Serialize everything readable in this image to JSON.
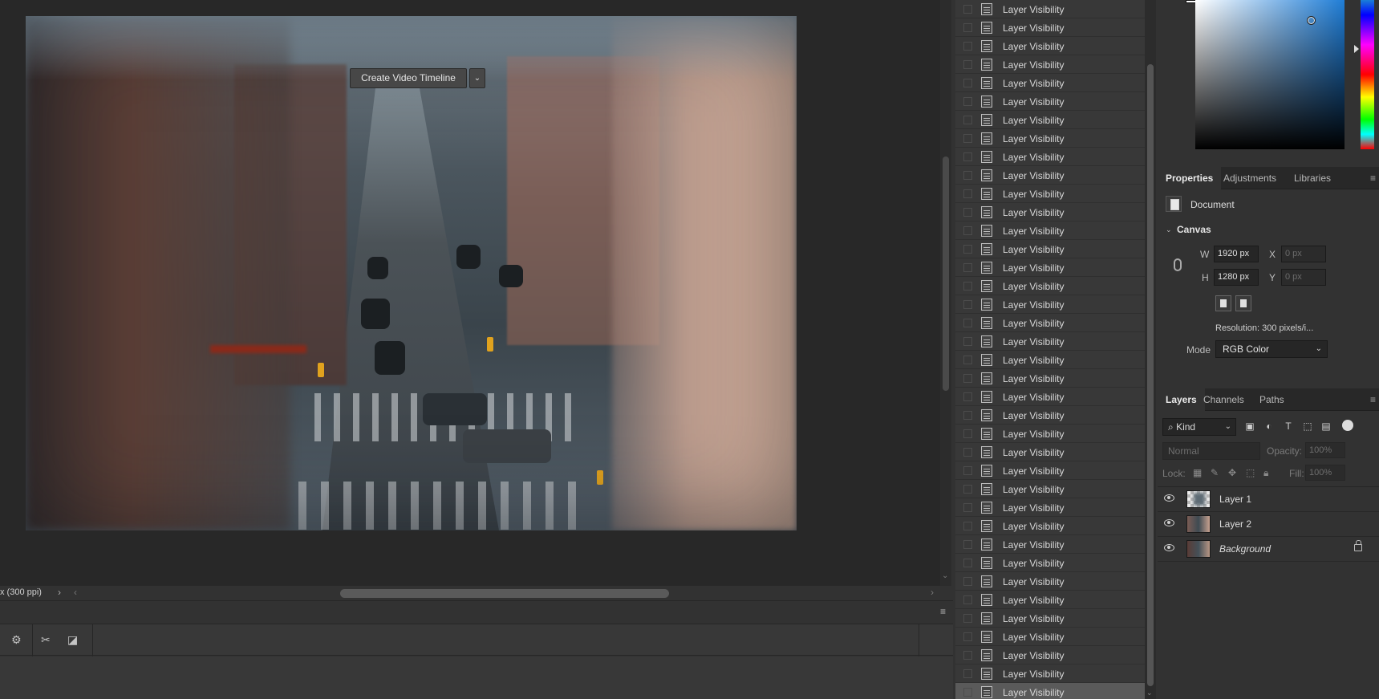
{
  "document": {
    "zoom_status": "x (300 ppi)"
  },
  "timeline": {
    "create_button_label": "Create Video Timeline"
  },
  "history": {
    "item_label": "Layer Visibility",
    "item_count": 38
  },
  "color": {
    "foreground": "#ffffff",
    "field_hue": "#1f7dd6"
  },
  "properties": {
    "tabs": [
      "Properties",
      "Adjustments",
      "Libraries"
    ],
    "active_tab": "Properties",
    "doc_label": "Document",
    "section_title": "Canvas",
    "w_label": "W",
    "h_label": "H",
    "x_label": "X",
    "y_label": "Y",
    "width_value": "1920 px",
    "height_value": "1280 px",
    "x_placeholder": "0 px",
    "y_placeholder": "0 px",
    "resolution": "Resolution: 300 pixels/i...",
    "mode_label": "Mode",
    "mode_value": "RGB Color"
  },
  "layers_panel": {
    "tabs": [
      "Layers",
      "Channels",
      "Paths"
    ],
    "active_tab": "Layers",
    "kind_filter": "Kind",
    "blend_mode": "Normal",
    "opacity_label": "Opacity:",
    "opacity_value": "100%",
    "lock_label": "Lock:",
    "fill_label": "Fill:",
    "fill_value": "100%",
    "layers": [
      {
        "name": "Layer 1",
        "visible": true,
        "locked": false
      },
      {
        "name": "Layer 2",
        "visible": true,
        "locked": false
      },
      {
        "name": "Background",
        "visible": true,
        "locked": true
      }
    ]
  }
}
